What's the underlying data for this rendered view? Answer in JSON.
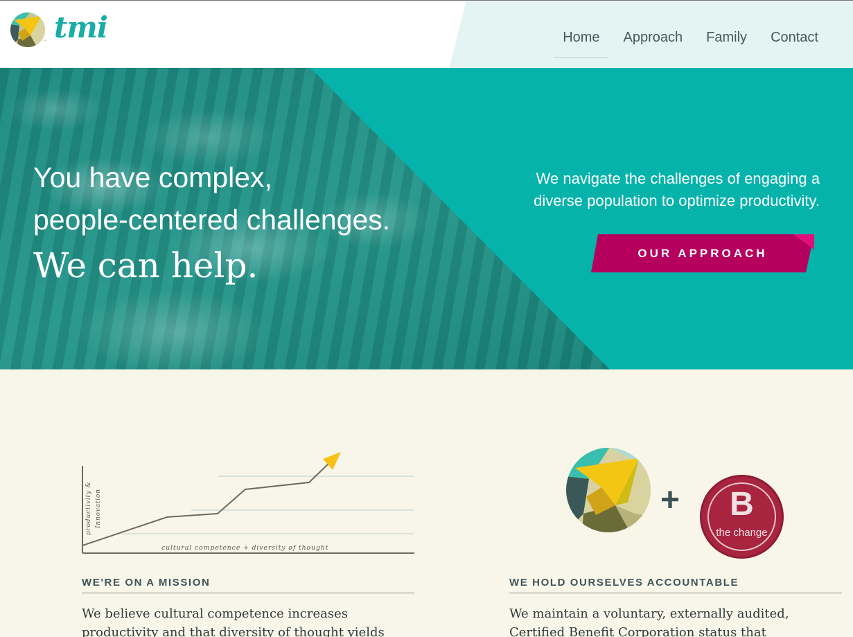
{
  "header": {
    "logo_text": "tmi",
    "logo_tm": "™",
    "nav": [
      {
        "label": "Home",
        "active": true
      },
      {
        "label": "Approach",
        "active": false
      },
      {
        "label": "Family",
        "active": false
      },
      {
        "label": "Contact",
        "active": false
      }
    ]
  },
  "hero": {
    "headline_line1": "You have complex,",
    "headline_line2": "people-centered challenges.",
    "headline_help": "We can help.",
    "subtext": "We navigate the challenges of engaging a diverse population to optimize productivity.",
    "cta_label": "OUR APPROACH"
  },
  "mission": {
    "graph_y_label_1": "productivity &",
    "graph_y_label_2": "Innovation",
    "graph_x_label": "cultural competence + diversity of thought",
    "title": "WE'RE ON A MISSION",
    "body": "We believe cultural competence increases productivity and that diversity of thought yields innovation. That's"
  },
  "accountable": {
    "plus": "+",
    "bcorp_letter": "B",
    "bcorp_text": "the change",
    "title": "WE HOLD OURSELVES ACCOUNTABLE",
    "body_before": "We maintain a voluntary, externally audited, ",
    "link_text": "Certified Benefit Corporation",
    "body_after": " status that institutionalizes a triple"
  },
  "colors": {
    "teal": "#05b3aa",
    "brand_teal_text": "#1aaca6",
    "magenta": "#b5005e",
    "cream": "#f8f6e9",
    "bcorp_red": "#a8243f"
  }
}
